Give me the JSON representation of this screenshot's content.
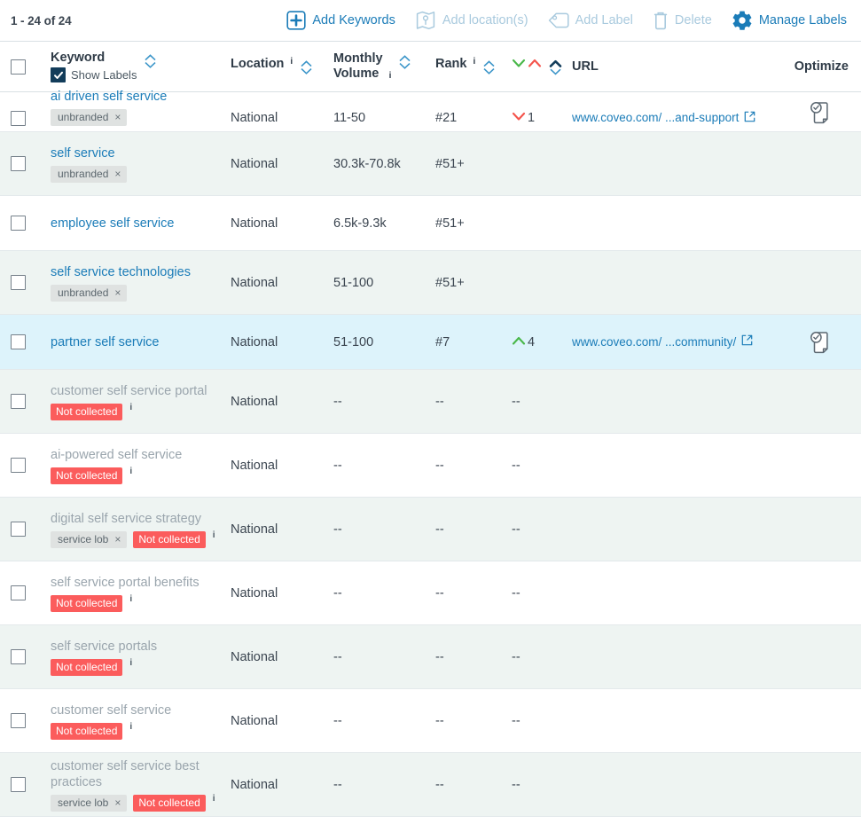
{
  "toolbar": {
    "count_text": "1 - 24 of 24",
    "actions": [
      {
        "label": "Add Keywords",
        "icon": "plus-square-icon",
        "enabled": true
      },
      {
        "label": "Add location(s)",
        "icon": "map-pin-icon",
        "enabled": false
      },
      {
        "label": "Add Label",
        "icon": "tag-icon",
        "enabled": false
      },
      {
        "label": "Delete",
        "icon": "trash-icon",
        "enabled": false
      },
      {
        "label": "Manage Labels",
        "icon": "gear-icon",
        "enabled": true
      }
    ]
  },
  "table": {
    "headers": {
      "keyword": "Keyword",
      "show_labels": "Show Labels",
      "show_labels_checked": true,
      "location": "Location",
      "monthly_volume_line1": "Monthly",
      "monthly_volume_line2": "Volume",
      "rank": "Rank",
      "url": "URL",
      "optimize": "Optimize",
      "info_marker": "i"
    },
    "colors": {
      "link": "#1b7cb8",
      "row_alt_bg": "#eef4f2",
      "row_selected_bg": "#ddf3fb",
      "badge_danger_bg": "#fb5c5c",
      "chip_bg": "#dfe2e1",
      "rank_up": "#49b749",
      "rank_down": "#f4544c",
      "checkbox_checked": "#123c5a"
    },
    "rows": [
      {
        "keyword": "ai driven self service",
        "muted": false,
        "chips": [
          {
            "text": "unbranded",
            "type": "label"
          }
        ],
        "info": false,
        "location": "National",
        "volume": "11-50",
        "rank": "#21",
        "change": "1",
        "change_dir": "down",
        "url": "www.coveo.com/ ...and-support",
        "optimize": true,
        "bg": "plain",
        "clipped": true
      },
      {
        "keyword": "self service",
        "muted": false,
        "chips": [
          {
            "text": "unbranded",
            "type": "label"
          }
        ],
        "info": false,
        "location": "National",
        "volume": "30.3k-70.8k",
        "rank": "#51+",
        "change": "",
        "change_dir": "none",
        "url": "",
        "optimize": false,
        "bg": "alt",
        "clipped": false
      },
      {
        "keyword": "employee self service",
        "muted": false,
        "chips": [],
        "info": false,
        "location": "National",
        "volume": "6.5k-9.3k",
        "rank": "#51+",
        "change": "",
        "change_dir": "none",
        "url": "",
        "optimize": false,
        "bg": "plain",
        "clipped": false
      },
      {
        "keyword": "self service technologies",
        "muted": false,
        "chips": [
          {
            "text": "unbranded",
            "type": "label"
          }
        ],
        "info": false,
        "location": "National",
        "volume": "51-100",
        "rank": "#51+",
        "change": "",
        "change_dir": "none",
        "url": "",
        "optimize": false,
        "bg": "alt",
        "clipped": false
      },
      {
        "keyword": "partner self service",
        "muted": false,
        "chips": [],
        "info": false,
        "location": "National",
        "volume": "51-100",
        "rank": "#7",
        "change": "4",
        "change_dir": "up",
        "url": "www.coveo.com/ ...community/",
        "optimize": true,
        "bg": "sel",
        "clipped": false
      },
      {
        "keyword": "customer self service portal",
        "muted": true,
        "chips": [
          {
            "text": "Not collected",
            "type": "danger"
          }
        ],
        "info": true,
        "location": "National",
        "volume": "--",
        "rank": "--",
        "change": "",
        "change_dir": "none",
        "url": "",
        "optimize": false,
        "bg": "alt",
        "clipped": false
      },
      {
        "keyword": "ai-powered self service",
        "muted": true,
        "chips": [
          {
            "text": "Not collected",
            "type": "danger"
          }
        ],
        "info": true,
        "location": "National",
        "volume": "--",
        "rank": "--",
        "change": "",
        "change_dir": "none",
        "url": "",
        "optimize": false,
        "bg": "plain",
        "clipped": false
      },
      {
        "keyword": "digital self service strategy",
        "muted": true,
        "chips": [
          {
            "text": "service lob",
            "type": "label"
          },
          {
            "text": "Not collected",
            "type": "danger"
          }
        ],
        "info": true,
        "location": "National",
        "volume": "--",
        "rank": "--",
        "change": "",
        "change_dir": "none",
        "url": "",
        "optimize": false,
        "bg": "alt",
        "clipped": false
      },
      {
        "keyword": "self service portal benefits",
        "muted": true,
        "chips": [
          {
            "text": "Not collected",
            "type": "danger"
          }
        ],
        "info": true,
        "location": "National",
        "volume": "--",
        "rank": "--",
        "change": "",
        "change_dir": "none",
        "url": "",
        "optimize": false,
        "bg": "plain",
        "clipped": false
      },
      {
        "keyword": "self service portals",
        "muted": true,
        "chips": [
          {
            "text": "Not collected",
            "type": "danger"
          }
        ],
        "info": true,
        "location": "National",
        "volume": "--",
        "rank": "--",
        "change": "",
        "change_dir": "none",
        "url": "",
        "optimize": false,
        "bg": "alt",
        "clipped": false
      },
      {
        "keyword": "customer self service",
        "muted": true,
        "chips": [
          {
            "text": "Not collected",
            "type": "danger"
          }
        ],
        "info": true,
        "location": "National",
        "volume": "--",
        "rank": "--",
        "change": "",
        "change_dir": "none",
        "url": "",
        "optimize": false,
        "bg": "plain",
        "clipped": false
      },
      {
        "keyword": "customer self service best practices",
        "muted": true,
        "chips": [
          {
            "text": "service lob",
            "type": "label"
          },
          {
            "text": "Not collected",
            "type": "danger"
          }
        ],
        "info": true,
        "location": "National",
        "volume": "--",
        "rank": "--",
        "change": "",
        "change_dir": "none",
        "url": "",
        "optimize": false,
        "bg": "alt",
        "clipped": false
      }
    ]
  }
}
